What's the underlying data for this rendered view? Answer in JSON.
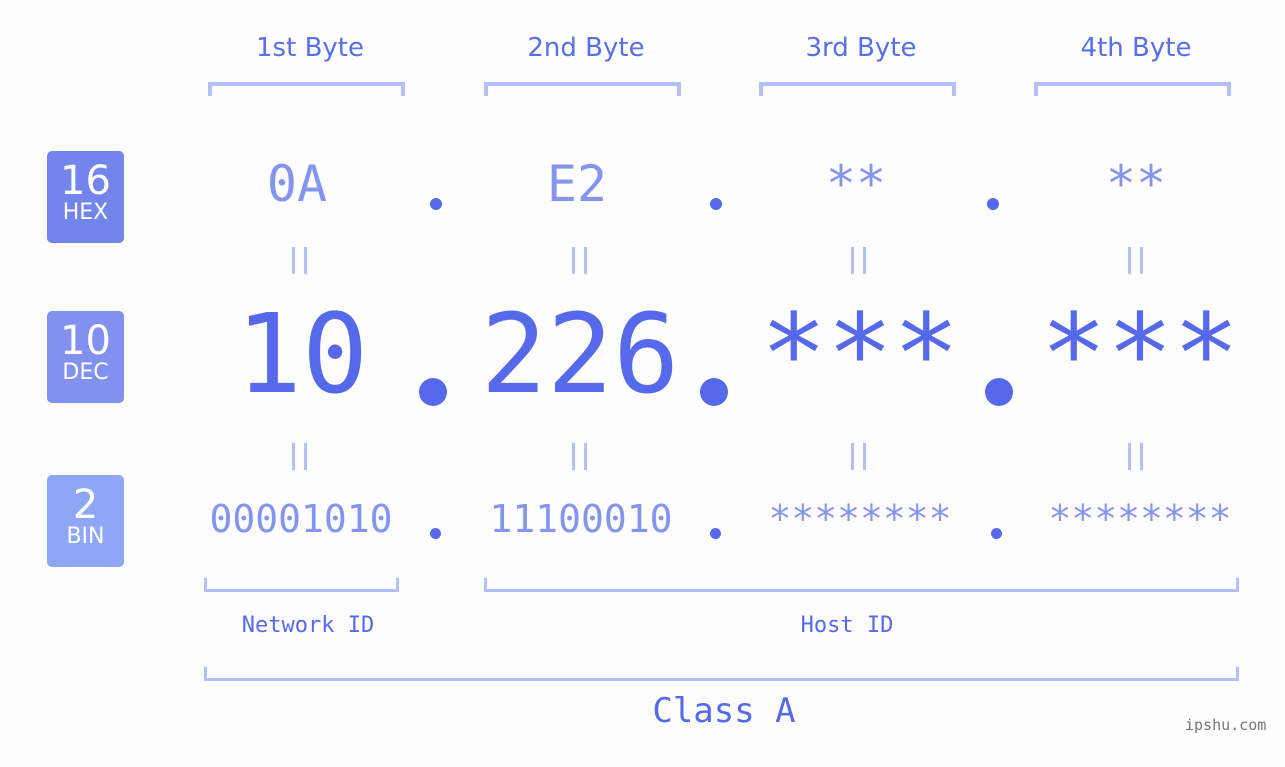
{
  "bytes": [
    {
      "label": "1st Byte",
      "hex": "0A",
      "dec": "10",
      "bin": "00001010"
    },
    {
      "label": "2nd Byte",
      "hex": "E2",
      "dec": "226",
      "bin": "11100010"
    },
    {
      "label": "3rd Byte",
      "hex": "**",
      "dec": "***",
      "bin": "********"
    },
    {
      "label": "4th Byte",
      "hex": "**",
      "dec": "***",
      "bin": "********"
    }
  ],
  "badges": {
    "hex": {
      "num": "16",
      "label": "HEX",
      "color": "#7384ec"
    },
    "dec": {
      "num": "10",
      "label": "DEC",
      "color": "#8291f0"
    },
    "bin": {
      "num": "2",
      "label": "BIN",
      "color": "#8fa6f7"
    }
  },
  "segments": {
    "network": "Network ID",
    "host": "Host ID"
  },
  "class_label": "Class A",
  "footer": "ipshu.com",
  "colors": {
    "accent": "#5669ea",
    "light": "#8595ee",
    "bracket": "#b3bff7"
  }
}
